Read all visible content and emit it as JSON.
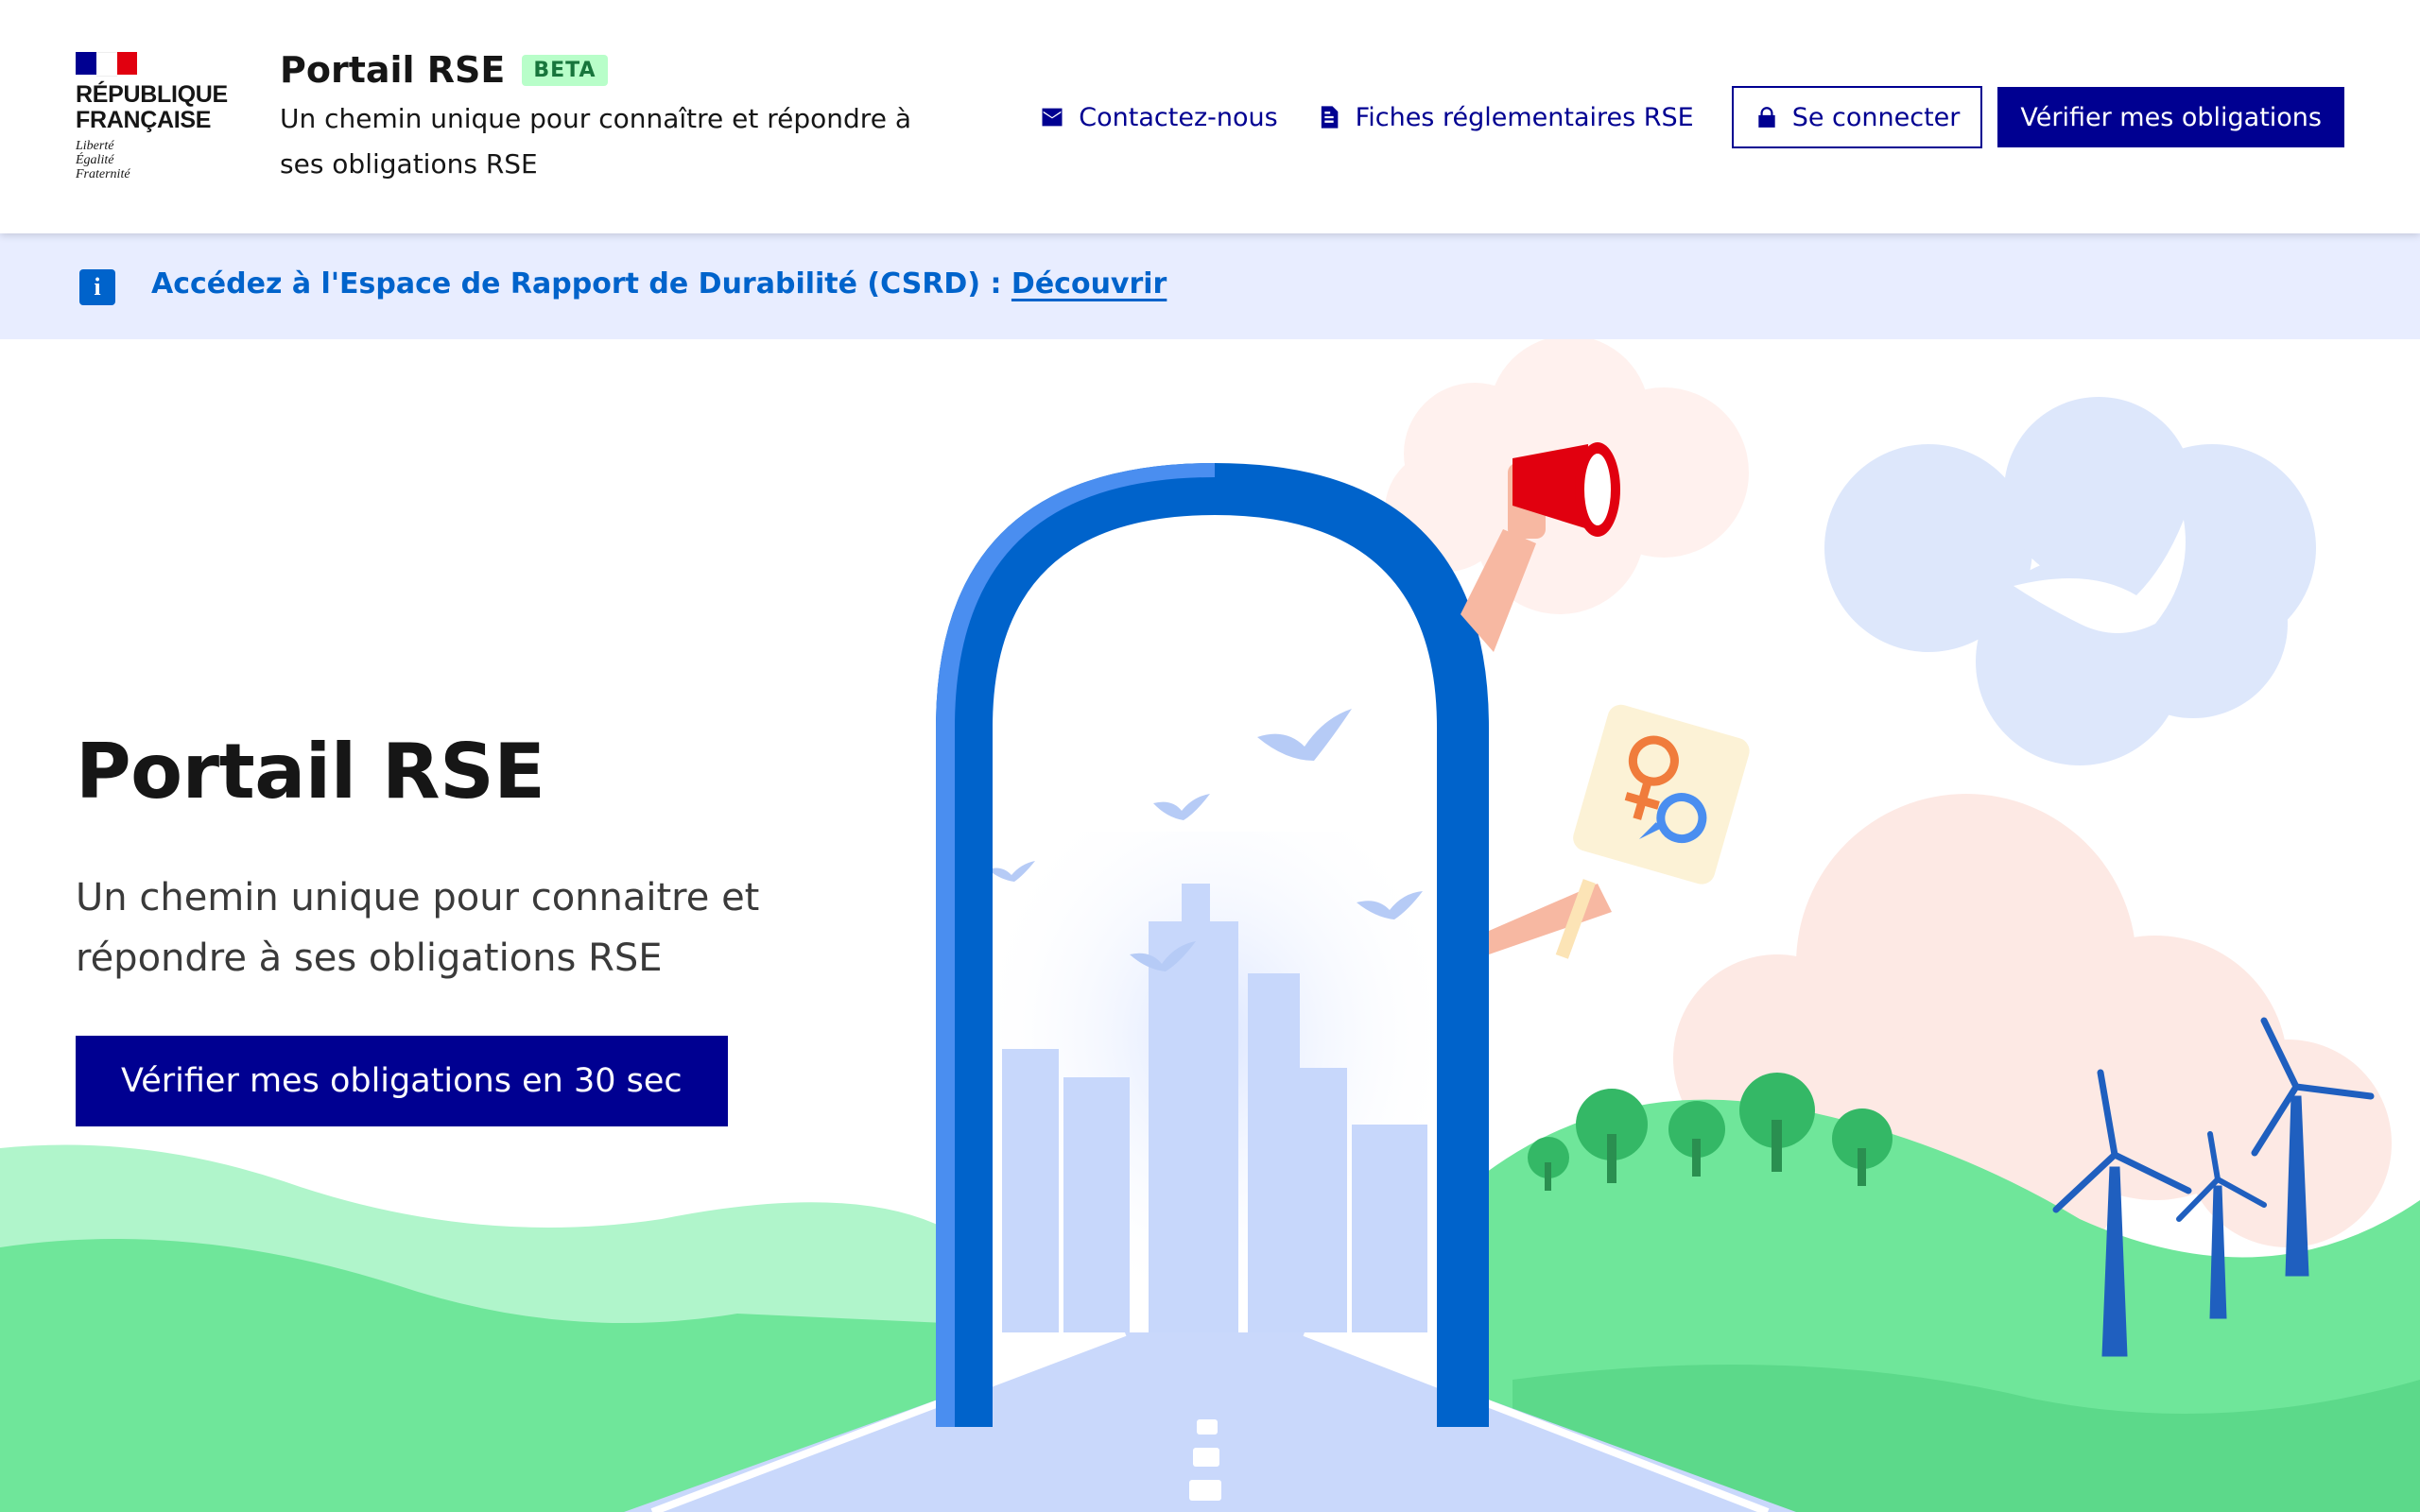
{
  "logo": {
    "name": "RÉPUBLIQUE\nFRANÇAISE",
    "motto": "Liberté\nÉgalité\nFraternité",
    "colors": [
      "#000091",
      "#ffffff",
      "#e1000f"
    ]
  },
  "header": {
    "title": "Portail RSE",
    "badge": "BETA",
    "tagline": "Un chemin unique pour connaître et répondre à ses obligations RSE",
    "nav": {
      "contact": {
        "label": "Contactez-nous",
        "icon": "mail-icon"
      },
      "fiches": {
        "label": "Fiches réglementaires RSE",
        "icon": "file-icon"
      },
      "login": {
        "label": "Se connecter",
        "icon": "lock-icon"
      },
      "verify": {
        "label": "Vérifier mes obligations"
      }
    }
  },
  "notice": {
    "icon": "info-icon",
    "text": "Accédez à l'Espace de Rapport de Durabilité (CSRD) : ",
    "link": "Découvrir"
  },
  "hero": {
    "title": "Portail RSE",
    "subtitle": "Un chemin unique pour connaitre et répondre à ses obligations RSE",
    "cta": "Vérifier mes obligations en 30 sec"
  },
  "colors": {
    "primary": "#000091",
    "info": "#0063cb",
    "notice_bg": "#e8edff",
    "badge_bg": "#b8fec9",
    "badge_text": "#18753c"
  }
}
